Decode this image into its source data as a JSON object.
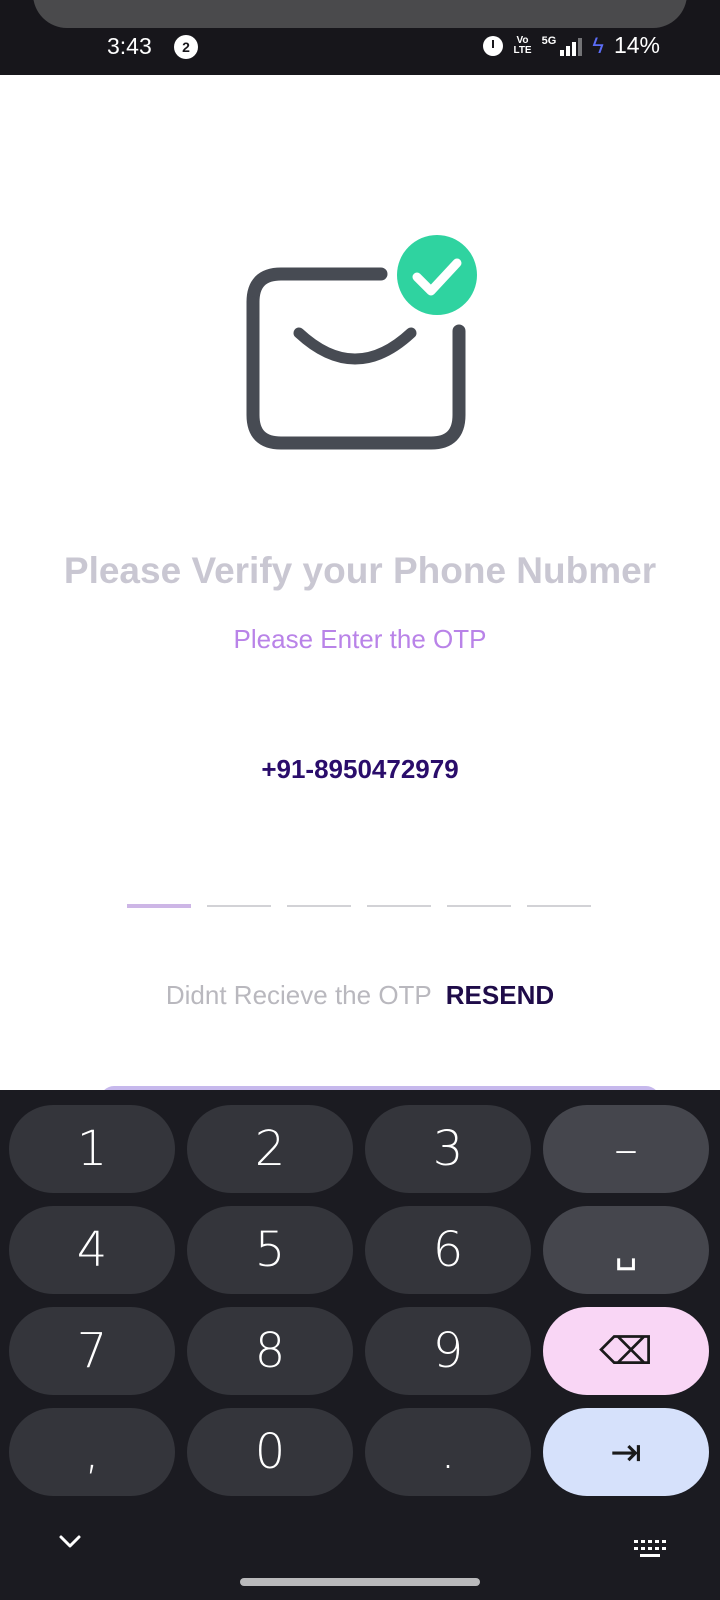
{
  "status_bar": {
    "time": "3:43",
    "notification_count": "2",
    "volte": "Vo\nLTE",
    "network": "5G",
    "battery": "14%"
  },
  "content": {
    "title": "Please Verify your Phone Nubmer",
    "subtitle": "Please Enter the OTP",
    "phone": "+91-8950472979",
    "otp_digits": [
      "",
      "",
      "",
      "",
      "",
      ""
    ],
    "resend_prompt": "Didnt Recieve the OTP",
    "resend_label": "RESEND"
  },
  "keyboard": {
    "rows": [
      [
        "1",
        "2",
        "3",
        "–"
      ],
      [
        "4",
        "5",
        "6",
        "␣"
      ],
      [
        "7",
        "8",
        "9",
        "⌫"
      ],
      [
        ",",
        "0",
        ".",
        "⇥"
      ]
    ]
  },
  "colors": {
    "accent_check": "#2fd3a0",
    "title": "#c9c7d2",
    "subtitle": "#b983e8",
    "phone": "#2a0d6b",
    "resend": "#1f0c49",
    "keyboard_bg": "#1b1b21"
  }
}
